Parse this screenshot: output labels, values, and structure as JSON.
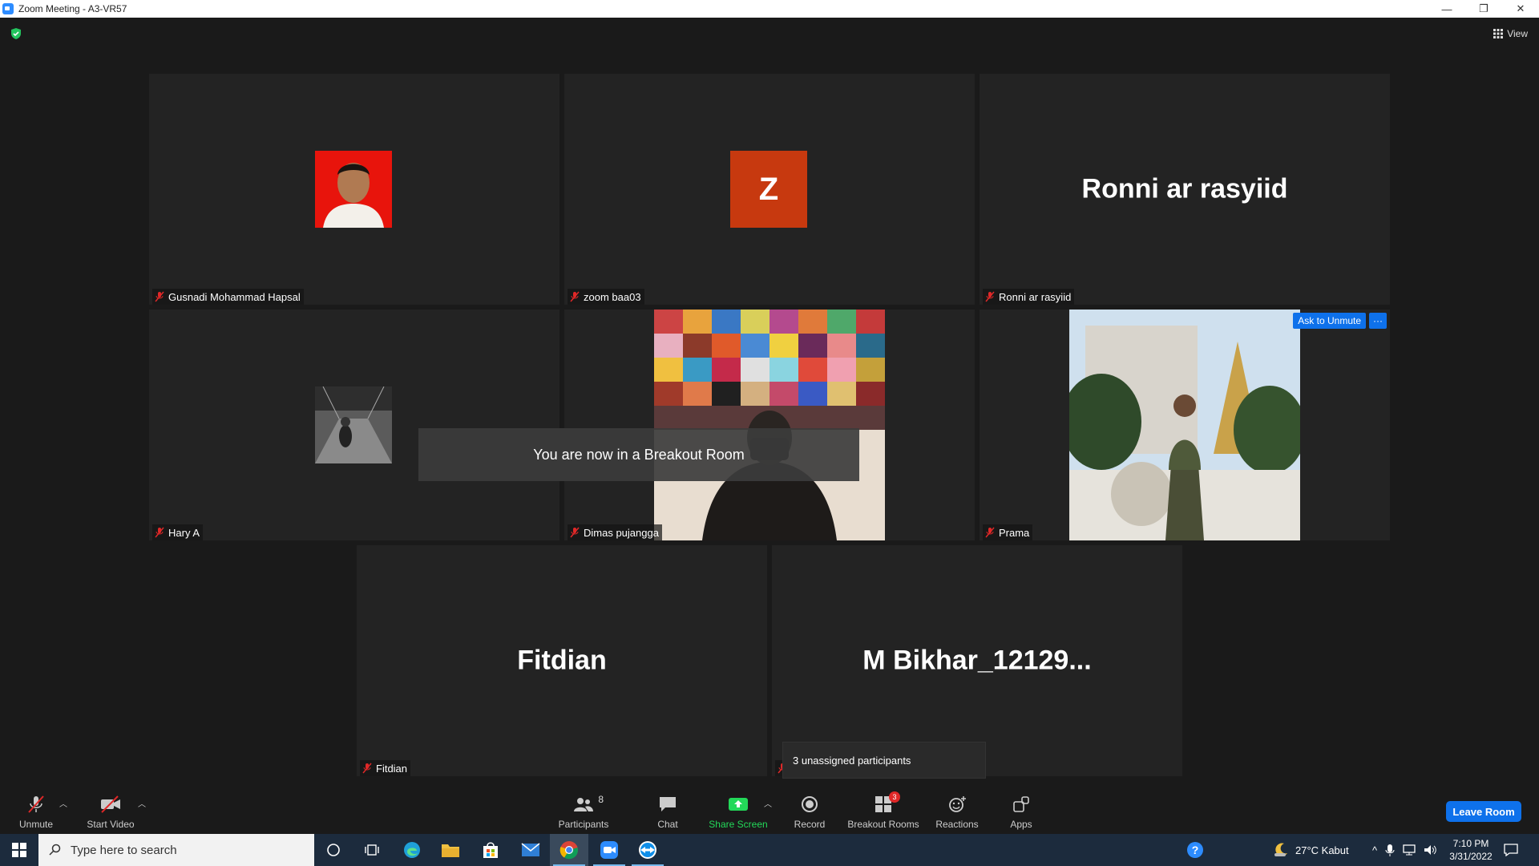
{
  "window": {
    "title": "Zoom Meeting - A3-VR57",
    "minimize": "—",
    "restore": "❐",
    "close": "✕"
  },
  "meeting": {
    "view_label": "View",
    "tiles": [
      {
        "name": "Gusnadi Mohammad Hapsal",
        "display": "photo"
      },
      {
        "name": "zoom baa03",
        "display": "initial",
        "initial": "Z",
        "color": "#c7390f"
      },
      {
        "name": "Ronni ar rasyiid",
        "display": "bigname",
        "big_name": "Ronni ar rasyiid"
      },
      {
        "name": "Hary A",
        "display": "photo"
      },
      {
        "name": "Dimas pujangga",
        "display": "video"
      },
      {
        "name": "Prama",
        "display": "video",
        "ask_unmute": "Ask to Unmute",
        "more": "···"
      },
      {
        "name": "Fitdian",
        "display": "bigname",
        "big_name": "Fitdian"
      },
      {
        "name": "",
        "display": "bigname",
        "big_name": "M  Bikhar_12129..."
      }
    ],
    "toast": "You are now in a Breakout Room",
    "tooltip": "3 unassigned participants"
  },
  "toolbar": {
    "unmute": "Unmute",
    "start_video": "Start Video",
    "participants": "Participants",
    "participants_count": "8",
    "chat": "Chat",
    "share_screen": "Share Screen",
    "record": "Record",
    "breakout_rooms": "Breakout Rooms",
    "breakout_badge": "3",
    "reactions": "Reactions",
    "apps": "Apps",
    "leave": "Leave Room",
    "share_color": "#23d959",
    "leave_color": "#0e71eb"
  },
  "taskbar": {
    "search_placeholder": "Type here to search",
    "weather": "27°C  Kabut",
    "time": "7:10 PM",
    "date": "3/31/2022"
  }
}
